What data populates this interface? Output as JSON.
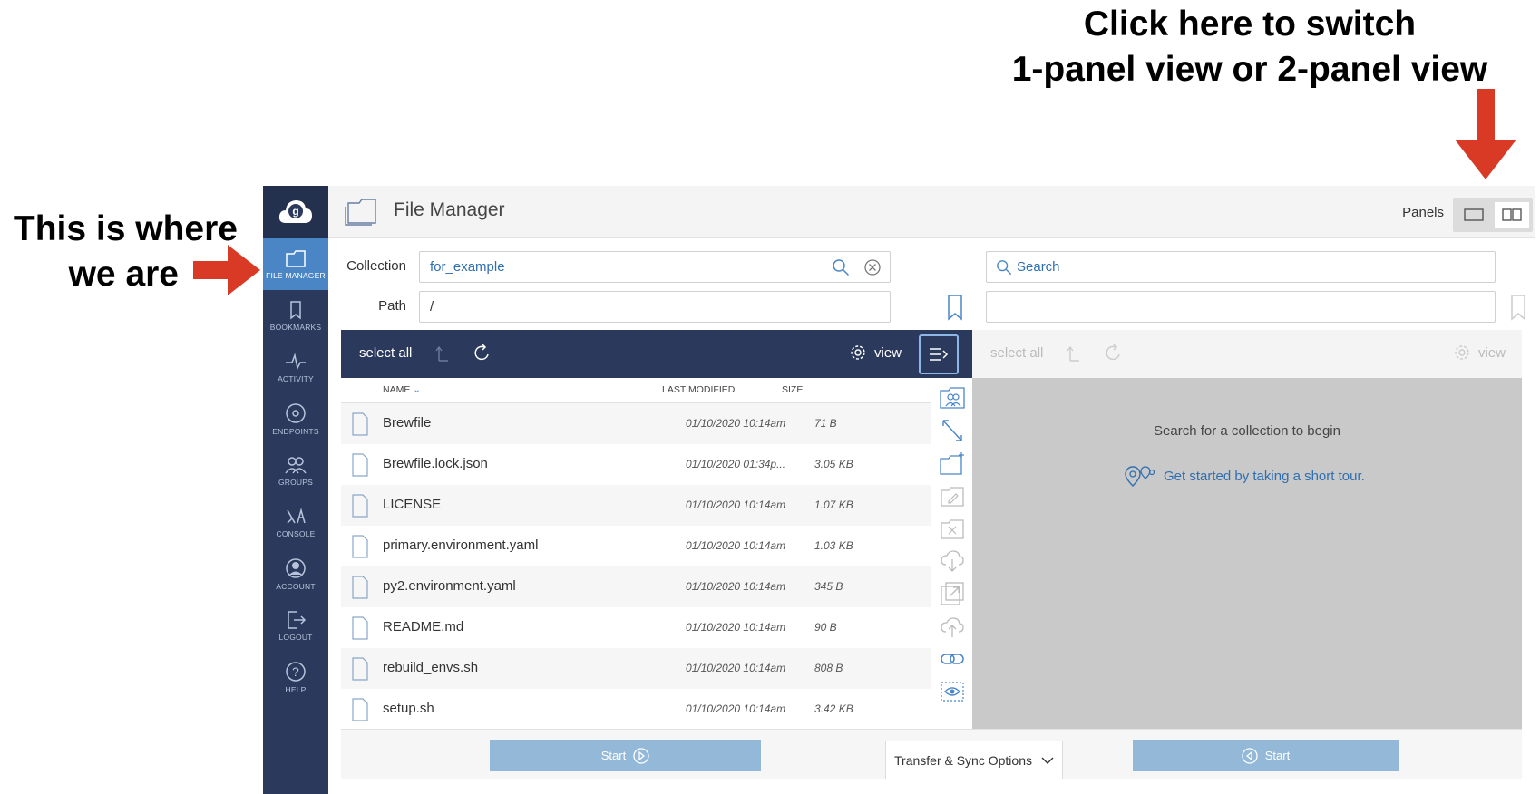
{
  "annotations": {
    "top_line1": "Click here to switch",
    "top_line2": "1-panel view or 2-panel view",
    "left_line1": "This is where",
    "left_line2": "we are"
  },
  "nav": {
    "items": [
      {
        "label": "FILE MANAGER",
        "icon": "folder-icon",
        "active": true
      },
      {
        "label": "BOOKMARKS",
        "icon": "bookmark-icon"
      },
      {
        "label": "ACTIVITY",
        "icon": "activity-icon"
      },
      {
        "label": "ENDPOINTS",
        "icon": "endpoints-icon"
      },
      {
        "label": "GROUPS",
        "icon": "groups-icon"
      },
      {
        "label": "CONSOLE",
        "icon": "console-icon"
      },
      {
        "label": "ACCOUNT",
        "icon": "account-icon"
      },
      {
        "label": "LOGOUT",
        "icon": "logout-icon"
      },
      {
        "label": "HELP",
        "icon": "help-icon"
      }
    ]
  },
  "header": {
    "title": "File Manager",
    "panels_label": "Panels"
  },
  "left_panel": {
    "collection_label": "Collection",
    "collection_value": "for_example",
    "path_label": "Path",
    "path_value": "/",
    "select_all": "select all",
    "view": "view",
    "columns": {
      "name": "NAME",
      "modified": "LAST MODIFIED",
      "size": "SIZE"
    },
    "files": [
      {
        "name": "Brewfile",
        "modified": "01/10/2020 10:14am",
        "size": "71 B"
      },
      {
        "name": "Brewfile.lock.json",
        "modified": "01/10/2020 01:34p...",
        "size": "3.05 KB"
      },
      {
        "name": "LICENSE",
        "modified": "01/10/2020 10:14am",
        "size": "1.07 KB"
      },
      {
        "name": "primary.environment.yaml",
        "modified": "01/10/2020 10:14am",
        "size": "1.03 KB"
      },
      {
        "name": "py2.environment.yaml",
        "modified": "01/10/2020 10:14am",
        "size": "345 B"
      },
      {
        "name": "README.md",
        "modified": "01/10/2020 10:14am",
        "size": "90 B"
      },
      {
        "name": "rebuild_envs.sh",
        "modified": "01/10/2020 10:14am",
        "size": "808 B"
      },
      {
        "name": "setup.sh",
        "modified": "01/10/2020 10:14am",
        "size": "3.42 KB"
      }
    ],
    "start": "Start"
  },
  "right_panel": {
    "search_placeholder": "Search",
    "select_all": "select all",
    "view": "view",
    "hint": "Search for a collection to begin",
    "tour_link": "Get started by taking a short tour.",
    "start": "Start"
  },
  "transfer_options": "Transfer & Sync Options",
  "colors": {
    "nav_bg": "#2b3a5c",
    "nav_active": "#4a86c6",
    "annotation_arrow": "#d93a26",
    "start_button": "#93b8d8",
    "link": "#2f6fb1"
  }
}
